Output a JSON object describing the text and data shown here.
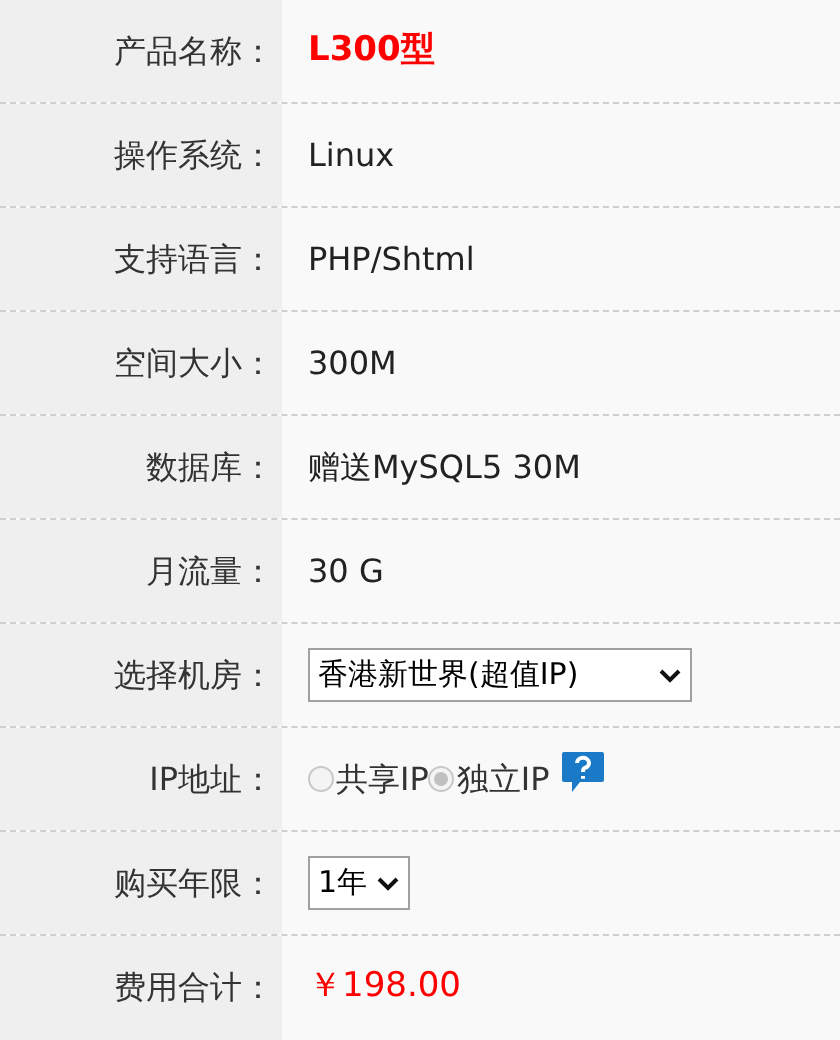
{
  "rows": [
    {
      "label": "产品名称：",
      "kind": "highlight",
      "value": "L300型"
    },
    {
      "label": "操作系统：",
      "kind": "text",
      "value": "Linux"
    },
    {
      "label": "支持语言：",
      "kind": "text",
      "value": "PHP/Shtml"
    },
    {
      "label": "空间大小：",
      "kind": "text",
      "value": "300M"
    },
    {
      "label": "数据库：",
      "kind": "text",
      "value": "赠送MySQL5 30M"
    },
    {
      "label": "月流量：",
      "kind": "text",
      "value": "30 G"
    },
    {
      "label": "选择机房：",
      "kind": "select",
      "value": "香港新世界(超值IP)",
      "wide": true
    },
    {
      "label": "IP地址：",
      "kind": "radio",
      "disabled": true,
      "options": [
        {
          "label": "共享IP",
          "selected": false
        },
        {
          "label": "独立IP",
          "selected": true
        }
      ],
      "help": true
    },
    {
      "label": "购买年限：",
      "kind": "select",
      "value": "1年",
      "wide": false
    },
    {
      "label": "费用合计：",
      "kind": "price",
      "value": "￥198.00"
    }
  ]
}
